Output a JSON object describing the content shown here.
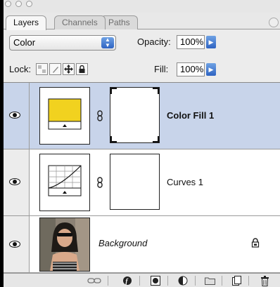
{
  "tabs": [
    {
      "label": "Layers"
    },
    {
      "label": "Channels"
    },
    {
      "label": "Paths"
    }
  ],
  "blend_mode": {
    "value": "Color"
  },
  "opacity": {
    "label": "Opacity:",
    "value": "100%"
  },
  "lock": {
    "label": "Lock:"
  },
  "fill": {
    "label": "Fill:",
    "value": "100%"
  },
  "layers": [
    {
      "name": "Color Fill 1",
      "selected": true,
      "fill_color": "#f1d21f"
    },
    {
      "name": "Curves 1",
      "selected": false
    },
    {
      "name": "Background",
      "selected": false,
      "locked": true
    }
  ],
  "colors": {
    "selection": "#c8d4ea",
    "accent_blue": "#2e63c2",
    "fill_swatch": "#f1d21f"
  },
  "icons": {
    "eye": "eye-icon",
    "chain": "chain-link-icon",
    "lock": "lock-icon",
    "bottom": [
      "link-layers-icon",
      "layer-style-icon",
      "add-mask-icon",
      "adjustment-layer-icon",
      "new-group-icon",
      "new-layer-icon",
      "trash-icon"
    ]
  }
}
